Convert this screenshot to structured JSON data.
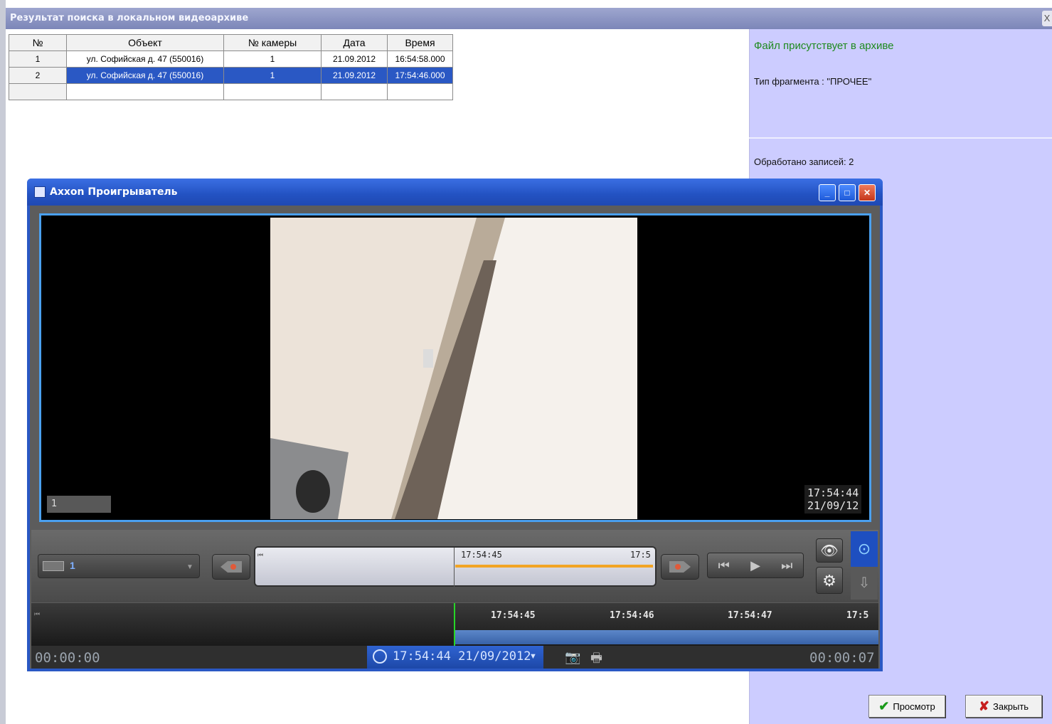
{
  "window": {
    "title": "Результат поиска в локальном видеоархиве",
    "close_glyph": "X"
  },
  "table": {
    "headers": [
      "№",
      "Объект",
      "№ камеры",
      "Дата",
      "Время"
    ],
    "rows": [
      {
        "num": "1",
        "object": "ул. Софийская д. 47 (550016)",
        "camera": "1",
        "date": "21.09.2012",
        "time": "16:54:58.000",
        "selected": false
      },
      {
        "num": "2",
        "object": "ул. Софийская д. 47 (550016)",
        "camera": "1",
        "date": "21.09.2012",
        "time": "17:54:46.000",
        "selected": true
      }
    ]
  },
  "info": {
    "file_status": "Файл присутствует в архиве",
    "fragment_type": "Тип фрагмента : \"ПРОЧЕЕ\"",
    "processed": "Обработано записей: 2"
  },
  "buttons": {
    "view": "Просмотр",
    "close": "Закрыть"
  },
  "player": {
    "title": "Axxon Проигрыватель",
    "camera_label": "1",
    "overlay_time": "17:54:44",
    "overlay_date": "21/09/12",
    "camera_select_value": "1",
    "mini_timeline": {
      "time_left": "17:54:45",
      "time_right": "17:5"
    },
    "timeline_ticks": [
      "17:54:45",
      "17:54:46",
      "17:54:47",
      "17:5"
    ],
    "time_start": "00:00:00",
    "time_end": "00:00:07",
    "datetime": "17:54:44 21/09/2012"
  },
  "colors": {
    "accent": "#2a58c4",
    "status_green": "#1e8a1e",
    "panel": "#ccccff",
    "timeline_recording": "#f2a424"
  }
}
